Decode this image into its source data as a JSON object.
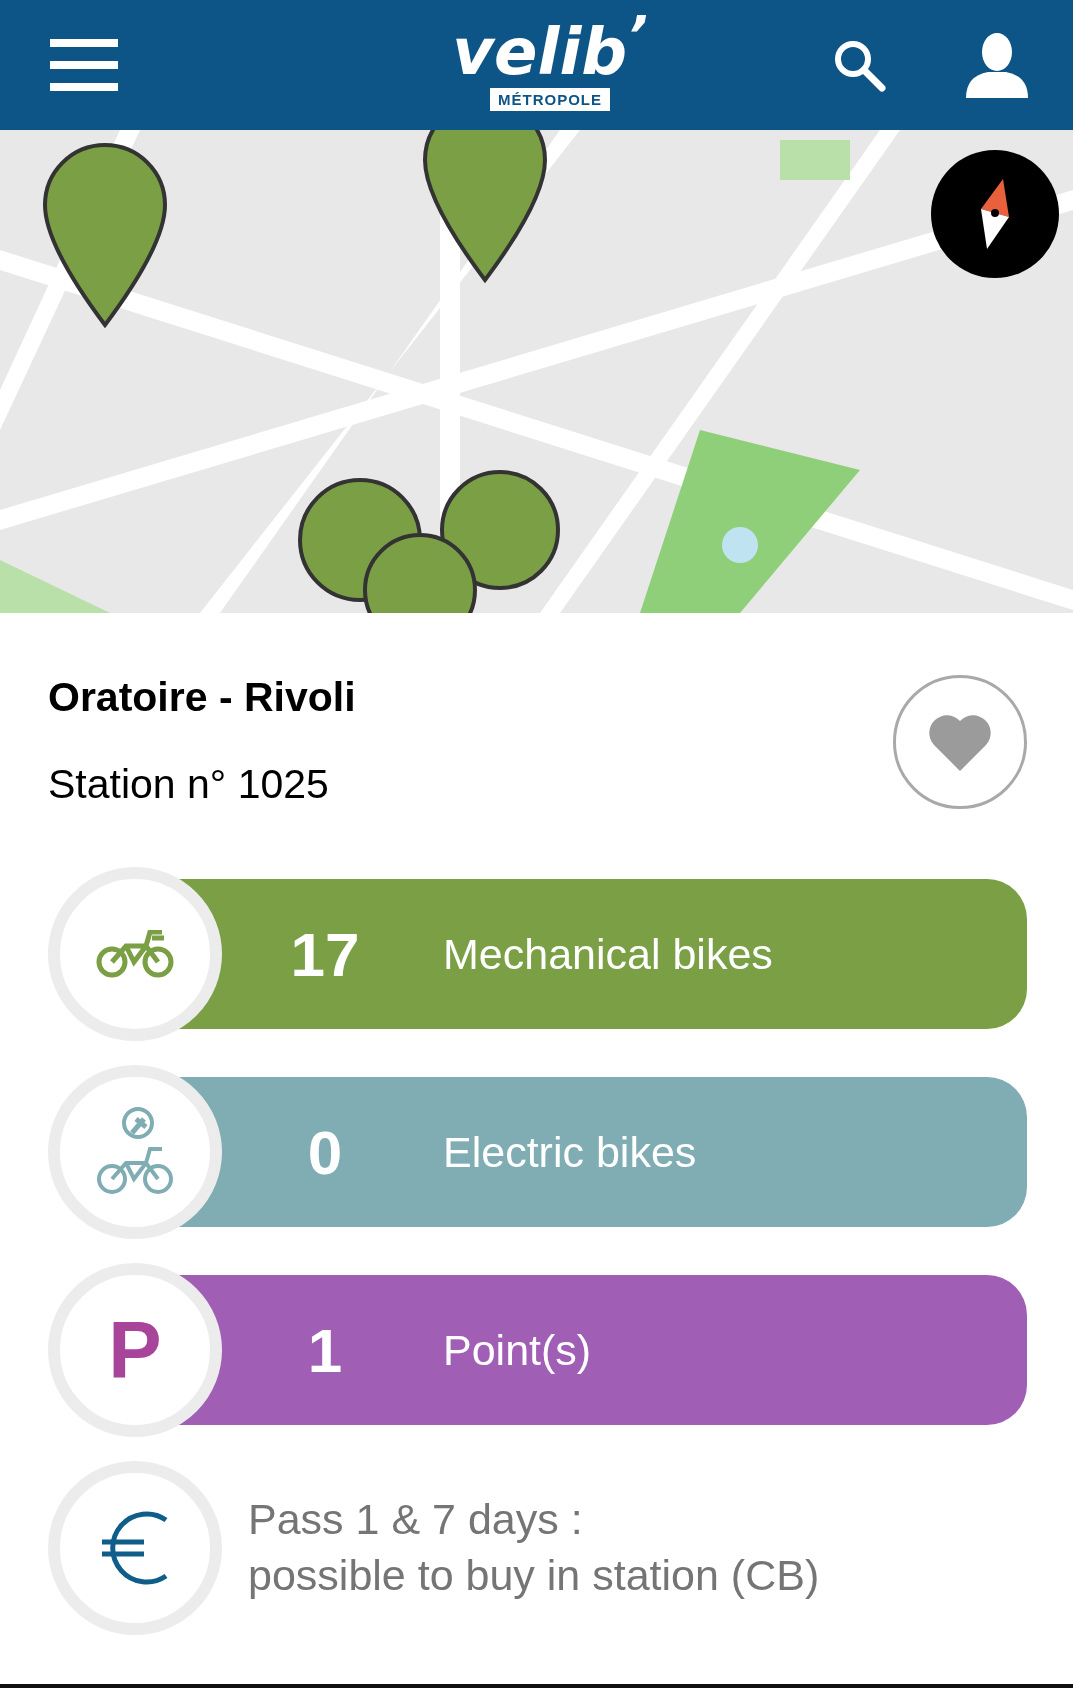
{
  "header": {
    "logo": "velib",
    "logo_mark": "’",
    "logo_sub": "MÉTROPOLE"
  },
  "station": {
    "name": "Oratoire - Rivoli",
    "number": "Station n° 1025",
    "favorite": false
  },
  "counts": [
    {
      "kind": "bike",
      "count": "17",
      "label": "Mechanical bikes",
      "color": "#7a9f45"
    },
    {
      "kind": "ebike",
      "count": "0",
      "label": "Electric bikes",
      "color": "#80adb3"
    },
    {
      "kind": "parking",
      "symbol": "P",
      "count": "1",
      "label": "Point(s)",
      "color": "#a05eb5"
    }
  ],
  "pass": {
    "lines": [
      "Pass 1 & 7 days :",
      "possible to buy in station (CB)"
    ]
  }
}
